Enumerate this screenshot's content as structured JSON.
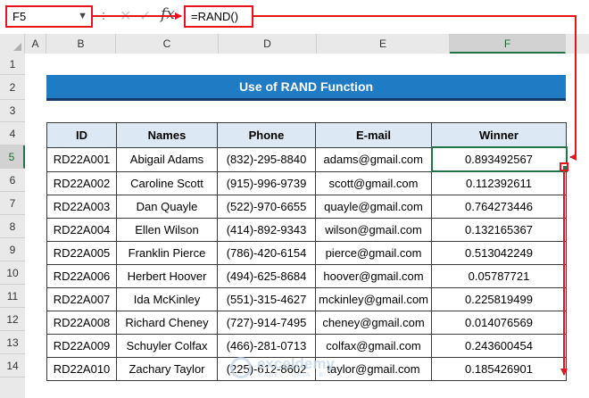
{
  "formula_bar": {
    "name_box": "F5",
    "separator": ":",
    "cancel": "✕",
    "enter": "✓",
    "fx": "fx",
    "formula": "=RAND()"
  },
  "columns": [
    "A",
    "B",
    "C",
    "D",
    "E",
    "F"
  ],
  "rows": [
    "1",
    "2",
    "3",
    "4",
    "5",
    "6",
    "7",
    "8",
    "9",
    "10",
    "11",
    "12",
    "13",
    "14"
  ],
  "banner": {
    "title": "Use of RAND Function"
  },
  "table": {
    "headers": [
      "ID",
      "Names",
      "Phone",
      "E-mail",
      "Winner"
    ],
    "rows": [
      [
        "RD22A001",
        "Abigail Adams",
        "(832)-295-8840",
        "adams@gmail.com",
        "0.893492567"
      ],
      [
        "RD22A002",
        "Caroline Scott",
        "(915)-996-9739",
        "scott@gmail.com",
        "0.112392611"
      ],
      [
        "RD22A003",
        "Dan Quayle",
        "(522)-970-6655",
        "quayle@gmail.com",
        "0.764273446"
      ],
      [
        "RD22A004",
        "Ellen Wilson",
        "(414)-892-9343",
        "wilson@gmail.com",
        "0.132165367"
      ],
      [
        "RD22A005",
        "Franklin Pierce",
        "(786)-420-6154",
        "pierce@gmail.com",
        "0.513042249"
      ],
      [
        "RD22A006",
        "Herbert Hoover",
        "(494)-625-8684",
        "hoover@gmail.com",
        "0.05787721"
      ],
      [
        "RD22A007",
        "Ida McKinley",
        "(551)-315-4627",
        "mckinley@gmail.com",
        "0.225819499"
      ],
      [
        "RD22A008",
        "Richard Cheney",
        "(727)-914-7495",
        "cheney@gmail.com",
        "0.014076569"
      ],
      [
        "RD22A009",
        "Schuyler Colfax",
        "(466)-281-0713",
        "colfax@gmail.com",
        "0.243600454"
      ],
      [
        "RD22A010",
        "Zachary Taylor",
        "(225)-612-8602",
        "taylor@gmail.com",
        "0.185426901"
      ]
    ]
  },
  "selection": {
    "column": "F",
    "row": "5"
  },
  "watermark": {
    "word": "exceldemy",
    "tagline": "EXCEL · DATA · BI"
  },
  "colors": {
    "highlight": "#e8141b",
    "banner": "#1f7cc4",
    "header_fill": "#dce9f5",
    "selection": "#217346"
  }
}
